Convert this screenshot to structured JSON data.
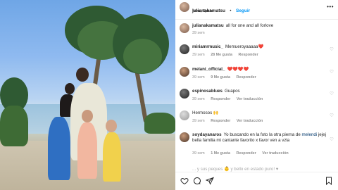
{
  "post_header": {
    "username": "julianakamatsu",
    "separator": "•",
    "follow_label": "Seguir",
    "location": "Ibiza, Spain",
    "more_label": "•••"
  },
  "caption": {
    "username": "julianakamatsu",
    "text": "all for one and all forlove",
    "time": "39 sem"
  },
  "comments": [
    {
      "username": "miriamrmusic_",
      "text": "Memueroyaaaaa❤️",
      "time": "39 sem",
      "likes": "28 Me gusta",
      "reply": "Responder"
    },
    {
      "username": "melani_official_",
      "text": "❤️❤️❤️❤️",
      "time": "39 sem",
      "likes": "9 Me gusta",
      "reply": "Responder"
    },
    {
      "username": "espinosablues",
      "text": "Guapos",
      "time": "39 sem",
      "reply": "Responder",
      "translate": "Ver traducción"
    },
    {
      "username": "",
      "text": "Hermosos 🙌",
      "time": "39 sem",
      "reply": "Responder",
      "translate": "Ver traducción"
    },
    {
      "username": "soydayanaros",
      "text": "Yo buscando en la foto la otra pierna de",
      "mention": "melendi",
      "text2": "jejej bella familia mi cantante favorito x favor ven a vzla",
      "time": "39 sem",
      "likes": "1 Me gusta",
      "reply": "Responder",
      "translate": "Ver traducción"
    }
  ],
  "faded_comment": "... y sus peques 👶 y bello en estado puro! ♥",
  "icons": {
    "like": "heart-icon",
    "comment": "comment-icon",
    "share": "send-icon",
    "save": "bookmark-icon"
  },
  "photo": {
    "description_icons": "photo"
  }
}
